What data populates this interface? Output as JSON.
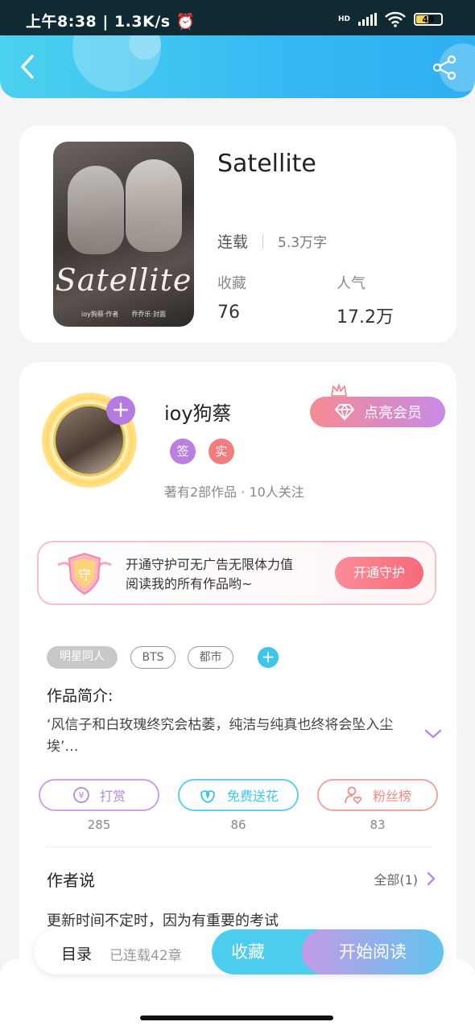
{
  "status_bar": {
    "time": "上午8:38",
    "speed": "1.3K/s",
    "dot": "·",
    "hd": "HD",
    "battery": "49"
  },
  "book": {
    "cover_title": "Satellite",
    "cover_subtitle": "ioy狗蔡·作者　　乔乔乐·封面",
    "title": "Satellite",
    "status": "连载",
    "words": "5.3万字",
    "stats": [
      {
        "label": "收藏",
        "value": "76"
      },
      {
        "label": "人气",
        "value": "17.2万"
      }
    ]
  },
  "author": {
    "name": "ioy狗蔡",
    "badges": [
      {
        "text": "签",
        "color": "#b980e0"
      },
      {
        "text": "实",
        "color": "#f07e7e"
      }
    ],
    "info": "著有2部作品 · 10人关注",
    "vip_label": "点亮会员"
  },
  "guard": {
    "icon_text": "守",
    "line1": "开通守护可无广告无限体力值",
    "line2": "阅读我的所有作品哟~",
    "button": "开通守护"
  },
  "tags": [
    "明星同人",
    "BTS",
    "都市"
  ],
  "intro": {
    "heading": "作品简介:",
    "text": "‘风信子和白玫瑰终究会枯萎，纯洁与纯真也终将会坠入尘埃’…"
  },
  "actions": [
    {
      "label": "打赏",
      "count": "285",
      "color": "#b58ae0"
    },
    {
      "label": "免费送花",
      "count": "86",
      "color": "#3fc4e8"
    },
    {
      "label": "粉丝榜",
      "count": "83",
      "color": "#ef8b8b"
    }
  ],
  "author_says": {
    "heading": "作者说",
    "all_label": "全部(1)",
    "text": "更新时间不定时，因为有重要的考试"
  },
  "bottom": {
    "toc": "目录",
    "chapters": "已连载42章",
    "favorite": "收藏",
    "read": "开始阅读"
  }
}
